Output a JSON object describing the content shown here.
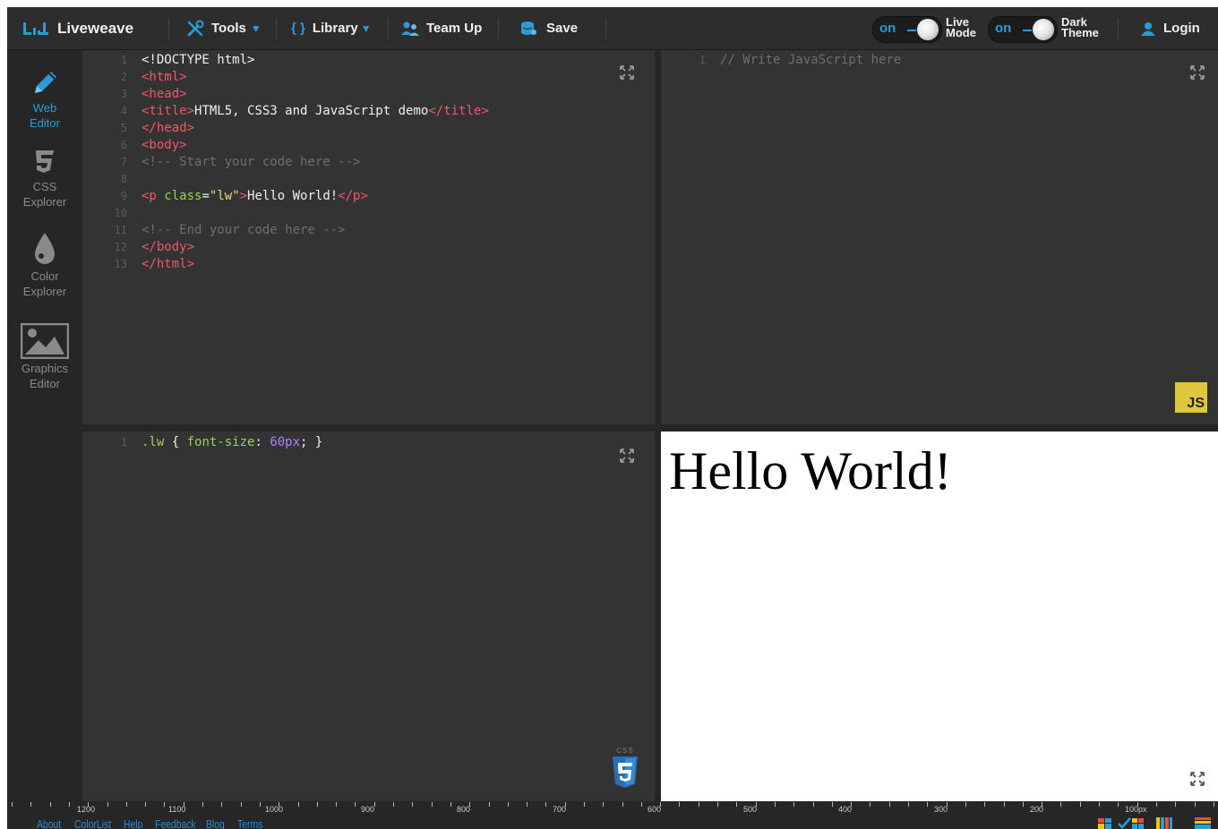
{
  "header": {
    "logo_text": "Liveweave",
    "tools_label": "Tools",
    "library_label": "Library",
    "library_braces": "{ }",
    "teamup_label": "Team Up",
    "save_label": "Save",
    "live_toggle_state": "on",
    "live_mode_label_1": "Live",
    "live_mode_label_2": "Mode",
    "dark_toggle_state": "on",
    "dark_theme_label_1": "Dark",
    "dark_theme_label_2": "Theme",
    "login_label": "Login"
  },
  "sidebar": {
    "items": [
      {
        "line1": "Web",
        "line2": "Editor",
        "icon": "pencil-icon"
      },
      {
        "line1": "CSS",
        "line2": "Explorer",
        "icon": "css3-icon"
      },
      {
        "line1": "Color",
        "line2": "Explorer",
        "icon": "droplet-icon"
      },
      {
        "line1": "Graphics",
        "line2": "Editor",
        "icon": "image-icon"
      }
    ]
  },
  "html_editor": {
    "line_numbers": [
      "1",
      "2",
      "3",
      "4",
      "5",
      "6",
      "7",
      "8",
      "9",
      "10",
      "11",
      "12",
      "13"
    ],
    "l1": "<!DOCTYPE html>",
    "l2": "<html>",
    "l3": "<head>",
    "l4_open": "<title>",
    "l4_text": "HTML5, CSS3 and JavaScript demo",
    "l4_close": "</title>",
    "l5": "</head>",
    "l6": "<body>",
    "l7": "<!-- Start your code here -->",
    "l9_open": "<p ",
    "l9_attr": "class",
    "l9_eq": "=",
    "l9_val": "\"lw\"",
    "l9_gt": ">",
    "l9_text": "Hello World!",
    "l9_close": "</p>",
    "l11": "<!-- End your code here -->",
    "l12": "</body>",
    "l13": "</html>"
  },
  "js_editor": {
    "line_number": "1",
    "l1": "// Write JavaScript here",
    "badge": "JS"
  },
  "css_editor": {
    "line_number": "1",
    "selector": ".lw",
    "brace_open": " { ",
    "property": "font-size",
    "colon": ": ",
    "value": "60px",
    "end": "; }",
    "badge_label": "CSS"
  },
  "preview": {
    "text": "Hello World!"
  },
  "ruler": {
    "labels": [
      "1200",
      "1100",
      "1000",
      "900",
      "800",
      "700",
      "600",
      "500",
      "400",
      "300",
      "200",
      "100px"
    ]
  },
  "footer": {
    "links": [
      "About",
      "ColorList",
      "Help",
      "Feedback",
      "Blog",
      "Terms"
    ]
  },
  "colors": {
    "accent": "#2a9bd8",
    "tag": "#f2566c",
    "comment": "#6e6e6e",
    "attr": "#98d44f",
    "string": "#e6db74",
    "number": "#ae81ff",
    "js_badge": "#f0db4f",
    "css_badge": "#2a6db5"
  }
}
